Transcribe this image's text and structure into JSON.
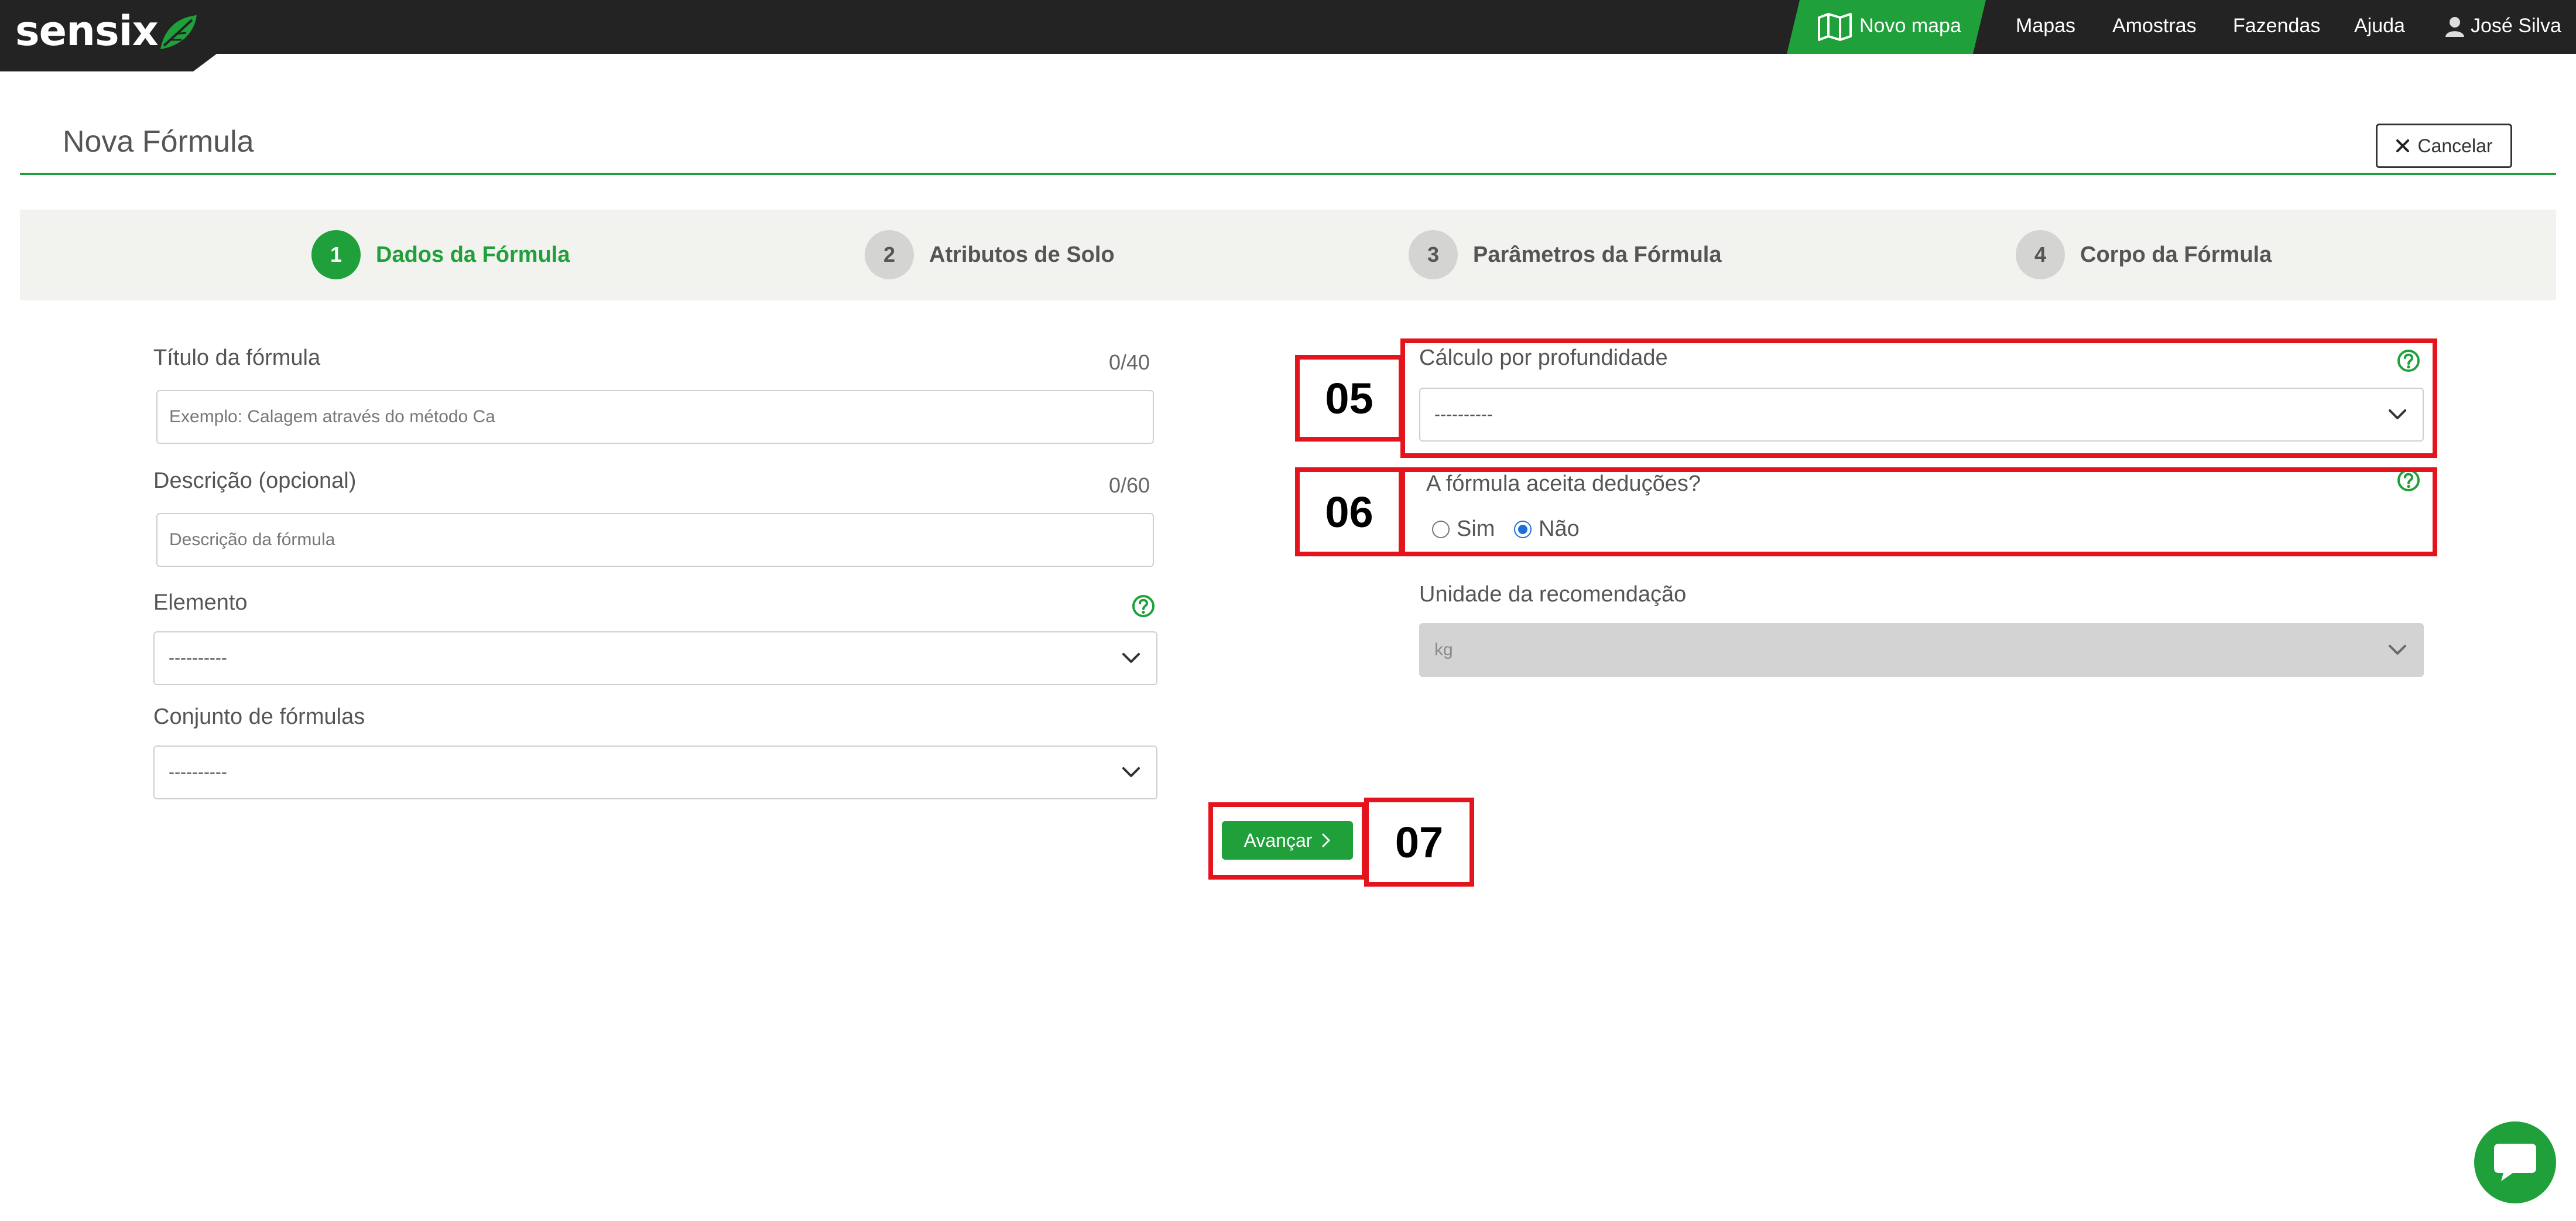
{
  "nav": {
    "logo": "sensix",
    "new_map": "Novo mapa",
    "links": [
      "Mapas",
      "Amostras",
      "Fazendas",
      "Ajuda"
    ],
    "user": "José Silva"
  },
  "header": {
    "title": "Nova Fórmula",
    "cancel": "Cancelar"
  },
  "steps": [
    {
      "num": "1",
      "label": "Dados da Fórmula",
      "active": true
    },
    {
      "num": "2",
      "label": "Atributos de Solo",
      "active": false
    },
    {
      "num": "3",
      "label": "Parâmetros da Fórmula",
      "active": false
    },
    {
      "num": "4",
      "label": "Corpo da Fórmula",
      "active": false
    }
  ],
  "form": {
    "title_label": "Título da fórmula",
    "title_counter": "0/40",
    "title_placeholder": "Exemplo: Calagem através do método Ca",
    "desc_label": "Descrição (opcional)",
    "desc_counter": "0/60",
    "desc_placeholder": "Descrição da fórmula",
    "element_label": "Elemento",
    "element_value": "----------",
    "set_label": "Conjunto de fórmulas",
    "set_value": "----------",
    "depth_label": "Cálculo por profundidade",
    "depth_value": "----------",
    "deductions_label": "A fórmula aceita deduções?",
    "deductions_yes": "Sim",
    "deductions_no": "Não",
    "deductions_selected": "Não",
    "unit_label": "Unidade da recomendação",
    "unit_value": "kg",
    "next": "Avançar"
  },
  "annotations": [
    "05",
    "06",
    "07"
  ],
  "colors": {
    "brand_green": "#1fa03a",
    "nav_dark": "#232323",
    "annotation_red": "#e3141b"
  }
}
